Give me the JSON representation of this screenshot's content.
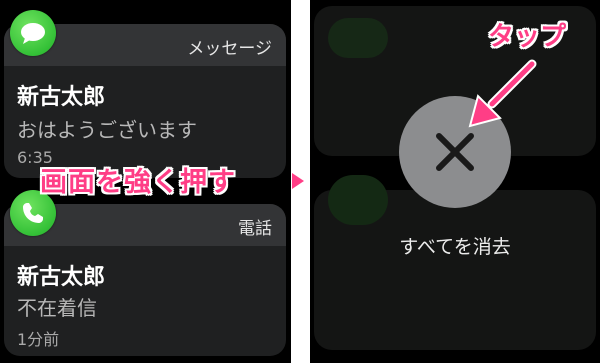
{
  "left": {
    "message_card": {
      "app_name": "メッセージ",
      "sender": "新古太郎",
      "body": "おはようございます",
      "time": "6:35",
      "icon": "message-bubble-icon"
    },
    "phone_card": {
      "app_name": "電話",
      "caller": "新古太郎",
      "body": "不在着信",
      "time": "1分前",
      "icon": "phone-handset-icon"
    },
    "instruction": "画面を強く押す"
  },
  "right": {
    "clear_all_label": "すべてを消去",
    "close_icon": "close-icon",
    "instruction": "タップ"
  },
  "colors": {
    "accent": "#ff3e86",
    "app_green": "#34c137",
    "background": "#000000",
    "button_gray": "#8c8d8f"
  }
}
